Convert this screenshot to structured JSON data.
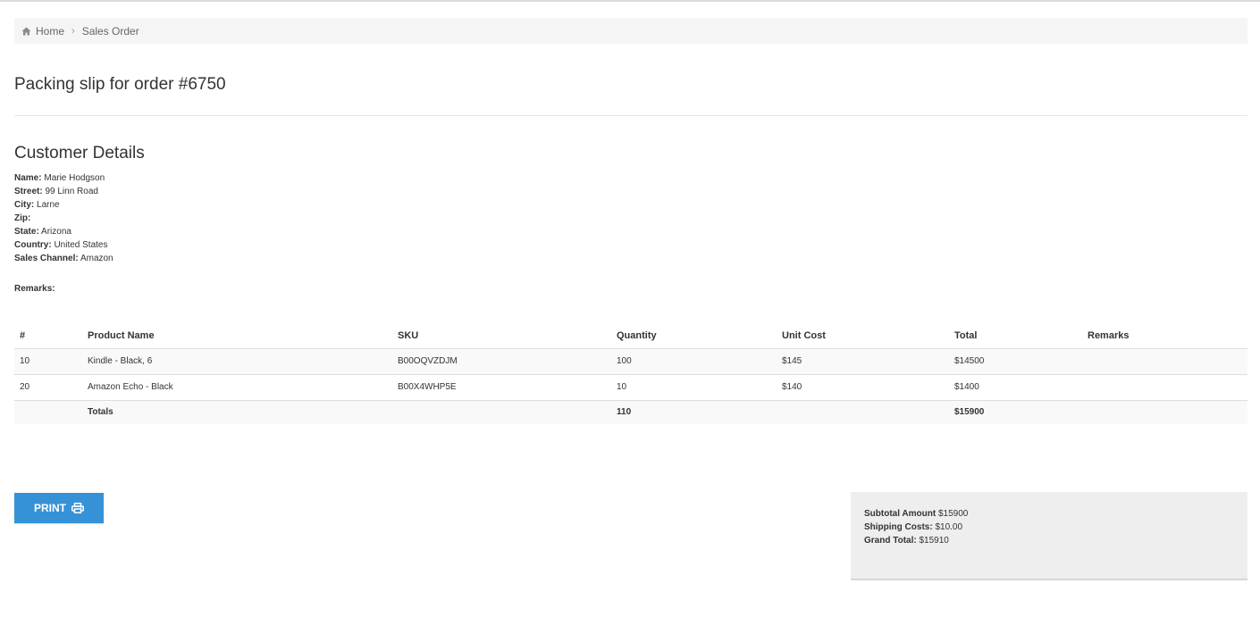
{
  "breadcrumb": {
    "home": "Home",
    "current": "Sales Order"
  },
  "page_title": "Packing slip for order #6750",
  "customer": {
    "heading": "Customer Details",
    "name_label": "Name:",
    "name": "Marie Hodgson",
    "street_label": "Street:",
    "street": "99 Linn Road",
    "city_label": "City:",
    "city": "Larne",
    "zip_label": "Zip:",
    "zip": "",
    "state_label": "State:",
    "state": "Arizona",
    "country_label": "Country:",
    "country": "United States",
    "channel_label": "Sales Channel:",
    "channel": "Amazon",
    "remarks_label": "Remarks:",
    "remarks": ""
  },
  "table": {
    "headers": [
      "#",
      "Product Name",
      "SKU",
      "Quantity",
      "Unit Cost",
      "Total",
      "Remarks"
    ],
    "rows": [
      [
        "10",
        "Kindle - Black, 6",
        "B00OQVZDJM",
        "100",
        "$145",
        "$14500",
        ""
      ],
      [
        "20",
        "Amazon Echo - Black",
        "B00X4WHP5E",
        "10",
        "$140",
        "$1400",
        ""
      ]
    ],
    "totals": {
      "label": "Totals",
      "quantity": "110",
      "total": "$15900"
    }
  },
  "print_button": {
    "label": "PRINT",
    "icon": "printer-icon"
  },
  "summary": {
    "subtotal_label": "Subtotal Amount",
    "subtotal": "$15900",
    "shipping_label": "Shipping Costs:",
    "shipping": "$10.00",
    "grand_label": "Grand Total:",
    "grand": "$15910"
  },
  "colors": {
    "accent": "#3592d7",
    "breadcrumb_bg": "#f5f5f5",
    "summary_bg": "#eeeeee"
  }
}
